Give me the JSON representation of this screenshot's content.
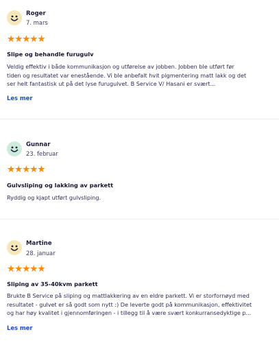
{
  "colors": {
    "star": "#ff8a00",
    "link": "#1a4fd0",
    "avatar_yellow": "#f6e7b8",
    "avatar_green": "#cdebdc",
    "divider": "#ececf2"
  },
  "reviews": [
    {
      "name": "Roger",
      "date": "7. mars",
      "stars": "★★★★★",
      "rating": 5,
      "title": "Slipe og behandle furugulv",
      "body": "Veldig effektiv i både kommunikasjon og utførelse av jobben. Jobben ble utført før\ntiden og resultatet var enestående. Vi ble anbefalt hvit pigmentering matt lakk og det\nser helt fantastisk ut på det lyse furugulvet. B Service V/ Hasani er svært...",
      "more": "Les mer",
      "avatar_icon": "smiley-avatar-icon"
    },
    {
      "name": "Gunnar",
      "date": "23. februar",
      "stars": "★★★★★",
      "rating": 5,
      "title": "Gulvsliping og lakking av parkett",
      "body": "Ryddig og kjapt utført gulvsliping.",
      "avatar_icon": "smiley-avatar-icon"
    },
    {
      "name": "Martine",
      "date": "28. januar",
      "stars": "★★★★★",
      "rating": 5,
      "title": "Sliping av 35-40kvm parkett",
      "body": "Brukte B Service på sliping og mattlakkering av en eldre parkett. Vi er storfornøyd med\nresultatet - gulvet er så godt som nytt :) De leverte godt på kommunikasjon, effektivitet\nog har høy kvalitet i gjennomføringen - i tillegg til å være svært konkurransedyktige p...",
      "more": "Les mer",
      "avatar_icon": "smiley-avatar-icon"
    }
  ]
}
